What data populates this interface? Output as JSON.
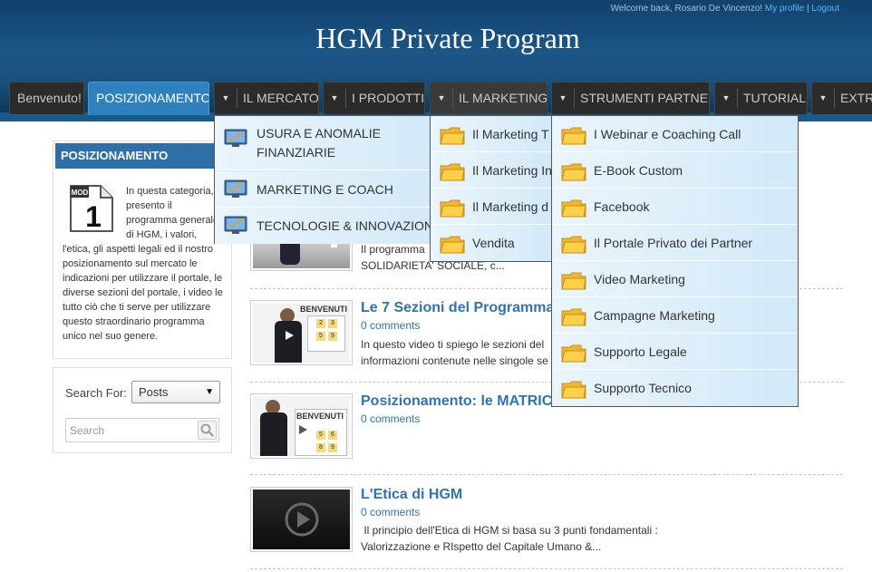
{
  "header": {
    "welcome": "Welcome back, Rosario De Vincenzo!",
    "my_profile": "My profile",
    "separator": "|",
    "logout": "Logout",
    "site_title": "HGM Private Program"
  },
  "nav": {
    "tabs": [
      {
        "label": "Benvenuto!"
      },
      {
        "label": "POSIZIONAMENTO"
      },
      {
        "label": "IL MERCATO"
      },
      {
        "label": "I PRODOTTI"
      },
      {
        "label": "IL MARKETING"
      },
      {
        "label": "STRUMENTI PARTNER"
      },
      {
        "label": "TUTORIAL"
      },
      {
        "label": "EXTRA"
      }
    ]
  },
  "sidebar": {
    "category_title": "POSIZIONAMENTO",
    "mod_badge": "MOD",
    "mod_number": "1",
    "category_description": "In questa categoria, presento il programma generale di HGM, i valori, l'etica, gli aspetti legali ed il nostro posizionamento sul mercato le indicazioni per utilizzare il portale, le diverse sezioni del portale, i video le tutto ciò che ti serve per utilizzare questo straordinario programma unico nel suo genere.",
    "search_for_label": "Search For:",
    "search_select_value": "Posts",
    "search_placeholder": "Search"
  },
  "posts": [
    {
      "title": "",
      "comments": "",
      "excerpt": "Il programma ... SOLIDARIETÀ SOCIALE, c..."
    },
    {
      "title": "Le 7 Sezioni del Programma",
      "comments": "0 comments",
      "excerpt": "In questo video ti spiego le sezioni del ... informazioni contenute nelle singole se..."
    },
    {
      "title": "Posizionamento: le MATRICI",
      "comments": "0 comments",
      "excerpt": ""
    },
    {
      "title": "L'Etica di HGM",
      "comments": "0 comments",
      "excerpt": " Il principio dell'Etica di HGM si basa su 3 punti fondamentali : Valorizzazione e RIspetto del Capitale Umano &..."
    }
  ],
  "post_snippets": {
    "p1_line1": "Il programma",
    "p1_line2": "SOLIDARIETA' SOCIALE, c...",
    "p2_line1": "In questo video ti spiego le sezioni del",
    "p2_line2": "informazioni contenute nelle singole se",
    "p4_line1": " Il principio dell'Etica di HGM si basa su 3 punti fondamentali :",
    "p4_line2": "Valorizzazione e RIspetto del Capitale Umano &..."
  },
  "thumb_text": {
    "benvenuti": "BENVENUTI"
  },
  "dropdowns": {
    "il_mercato": [
      {
        "label_line1": "USURA E ANOMALIE",
        "label_line2": "FINANZIARIE"
      },
      {
        "label_line1": "MARKETING E COACH",
        "label_line2": ""
      },
      {
        "label_line1": "TECNOLOGIE & INNOVAZIONE",
        "label_line2": ""
      }
    ],
    "il_marketing": [
      {
        "label": "Il Marketing T"
      },
      {
        "label": "Il Marketing In"
      },
      {
        "label": "Il Marketing d"
      },
      {
        "label": "Vendita"
      }
    ],
    "strumenti_partner": [
      {
        "label": "I Webinar e Coaching Call"
      },
      {
        "label": "E-Book Custom"
      },
      {
        "label": "Facebook"
      },
      {
        "label": "Il Portale Privato dei Partner"
      },
      {
        "label": "Video Marketing"
      },
      {
        "label": "Campagne Marketing"
      },
      {
        "label": "Supporto Legale"
      },
      {
        "label": "Supporto Tecnico"
      }
    ]
  },
  "colors": {
    "header_dark": "#12416a",
    "active_tab": "#2f81bd",
    "link_blue": "#2f74b0",
    "menu_bg": "#d8ecf8"
  }
}
